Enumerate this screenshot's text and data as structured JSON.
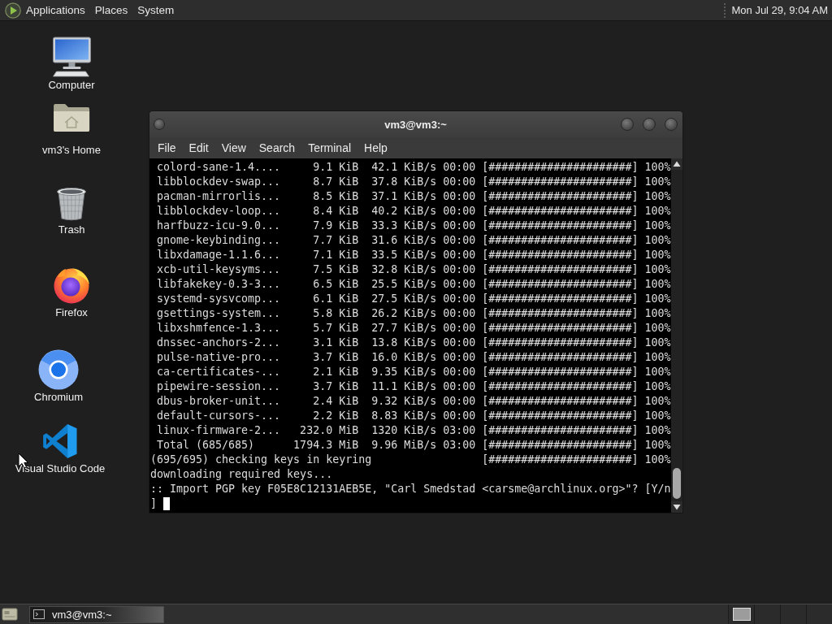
{
  "top_panel": {
    "menus": [
      "Applications",
      "Places",
      "System"
    ],
    "clock": "Mon Jul 29, 9:04 AM"
  },
  "desktop_icons": [
    {
      "label": "Computer",
      "kind": "monitor"
    },
    {
      "label": "vm3's Home",
      "kind": "home_folder"
    },
    {
      "label": "Trash",
      "kind": "trash"
    },
    {
      "label": "Firefox",
      "kind": "flame_globe"
    },
    {
      "label": "Chromium",
      "kind": "ring"
    },
    {
      "label": "Visual Studio Code",
      "kind": "ribbon"
    }
  ],
  "terminal_window": {
    "title": "vm3@vm3:~",
    "menu": [
      "File",
      "Edit",
      "View",
      "Search",
      "Terminal",
      "Help"
    ],
    "lines": [
      " colord-sane-1.4....     9.1 KiB  42.1 KiB/s 00:00 [######################] 100%",
      " libblockdev-swap...     8.7 KiB  37.8 KiB/s 00:00 [######################] 100%",
      " pacman-mirrorlis...     8.5 KiB  37.1 KiB/s 00:00 [######################] 100%",
      " libblockdev-loop...     8.4 KiB  40.2 KiB/s 00:00 [######################] 100%",
      " harfbuzz-icu-9.0...     7.9 KiB  33.3 KiB/s 00:00 [######################] 100%",
      " gnome-keybinding...     7.7 KiB  31.6 KiB/s 00:00 [######################] 100%",
      " libxdamage-1.1.6...     7.1 KiB  33.5 KiB/s 00:00 [######################] 100%",
      " xcb-util-keysyms...     7.5 KiB  32.8 KiB/s 00:00 [######################] 100%",
      " libfakekey-0.3-3...     6.5 KiB  25.5 KiB/s 00:00 [######################] 100%",
      " systemd-sysvcomp...     6.1 KiB  27.5 KiB/s 00:00 [######################] 100%",
      " gsettings-system...     5.8 KiB  26.2 KiB/s 00:00 [######################] 100%",
      " libxshmfence-1.3...     5.7 KiB  27.7 KiB/s 00:00 [######################] 100%",
      " dnssec-anchors-2...     3.1 KiB  13.8 KiB/s 00:00 [######################] 100%",
      " pulse-native-pro...     3.7 KiB  16.0 KiB/s 00:00 [######################] 100%",
      " ca-certificates-...     2.1 KiB  9.35 KiB/s 00:00 [######################] 100%",
      " pipewire-session...     3.7 KiB  11.1 KiB/s 00:00 [######################] 100%",
      " dbus-broker-unit...     2.4 KiB  9.32 KiB/s 00:00 [######################] 100%",
      " default-cursors-...     2.2 KiB  8.83 KiB/s 00:00 [######################] 100%",
      " linux-firmware-2...   232.0 MiB  1320 KiB/s 03:00 [######################] 100%",
      " Total (685/685)      1794.3 MiB  9.96 MiB/s 03:00 [######################] 100%",
      "(695/695) checking keys in keyring                 [######################] 100%",
      "downloading required keys...",
      ":: Import PGP key F05E8C12131AEB5E, \"Carl Smedstad <carsme@archlinux.org>\"? [Y/n",
      "]"
    ]
  },
  "taskbar": {
    "tasks": [
      {
        "label": "vm3@vm3:~",
        "selected": true
      }
    ],
    "workspaces": [
      {
        "occupied": true
      },
      {
        "occupied": false
      },
      {
        "occupied": false
      },
      {
        "occupied": false
      }
    ]
  }
}
